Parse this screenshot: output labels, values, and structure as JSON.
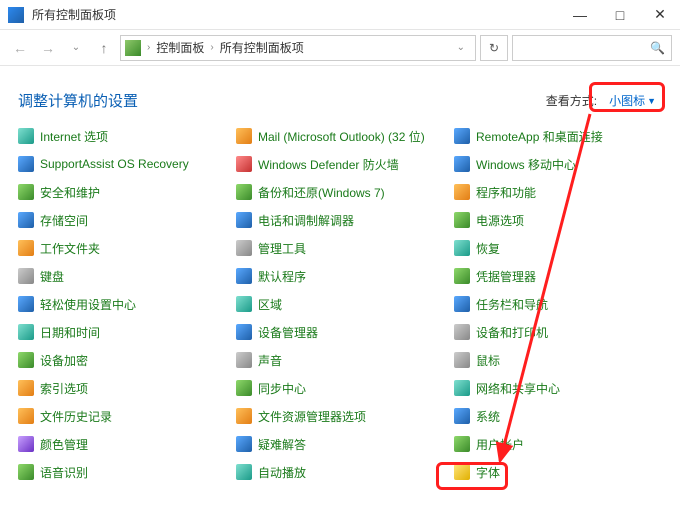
{
  "window": {
    "title": "所有控制面板项",
    "min": "—",
    "max": "□",
    "close": "✕"
  },
  "nav": {
    "back": "←",
    "forward": "→",
    "up": "↑",
    "crumb1": "控制面板",
    "crumb2": "所有控制面板项",
    "refresh": "↻",
    "search_icon": "🔍"
  },
  "header": {
    "heading": "调整计算机的设置",
    "view_label": "查看方式:",
    "view_value": "小图标"
  },
  "items": {
    "col1": [
      {
        "label": "Internet 选项",
        "ic": "ic-teal"
      },
      {
        "label": "SupportAssist OS Recovery",
        "ic": "ic-blue"
      },
      {
        "label": "安全和维护",
        "ic": "ic-green"
      },
      {
        "label": "存储空间",
        "ic": "ic-blue"
      },
      {
        "label": "工作文件夹",
        "ic": "ic-orange"
      },
      {
        "label": "键盘",
        "ic": "ic-gray"
      },
      {
        "label": "轻松使用设置中心",
        "ic": "ic-blue"
      },
      {
        "label": "日期和时间",
        "ic": "ic-teal"
      },
      {
        "label": "设备加密",
        "ic": "ic-green"
      },
      {
        "label": "索引选项",
        "ic": "ic-orange"
      },
      {
        "label": "文件历史记录",
        "ic": "ic-orange"
      },
      {
        "label": "颜色管理",
        "ic": "ic-purple"
      },
      {
        "label": "语音识别",
        "ic": "ic-green"
      }
    ],
    "col2": [
      {
        "label": "Mail (Microsoft Outlook) (32 位)",
        "ic": "ic-orange"
      },
      {
        "label": "Windows Defender 防火墙",
        "ic": "ic-red"
      },
      {
        "label": "备份和还原(Windows 7)",
        "ic": "ic-green"
      },
      {
        "label": "电话和调制解调器",
        "ic": "ic-blue"
      },
      {
        "label": "管理工具",
        "ic": "ic-gray"
      },
      {
        "label": "默认程序",
        "ic": "ic-blue"
      },
      {
        "label": "区域",
        "ic": "ic-teal"
      },
      {
        "label": "设备管理器",
        "ic": "ic-blue"
      },
      {
        "label": "声音",
        "ic": "ic-gray"
      },
      {
        "label": "同步中心",
        "ic": "ic-green"
      },
      {
        "label": "文件资源管理器选项",
        "ic": "ic-orange"
      },
      {
        "label": "疑难解答",
        "ic": "ic-blue"
      },
      {
        "label": "自动播放",
        "ic": "ic-teal"
      }
    ],
    "col3": [
      {
        "label": "RemoteApp 和桌面连接",
        "ic": "ic-blue"
      },
      {
        "label": "Windows 移动中心",
        "ic": "ic-blue"
      },
      {
        "label": "程序和功能",
        "ic": "ic-orange"
      },
      {
        "label": "电源选项",
        "ic": "ic-green"
      },
      {
        "label": "恢复",
        "ic": "ic-teal"
      },
      {
        "label": "凭据管理器",
        "ic": "ic-green"
      },
      {
        "label": "任务栏和导航",
        "ic": "ic-blue"
      },
      {
        "label": "设备和打印机",
        "ic": "ic-gray"
      },
      {
        "label": "鼠标",
        "ic": "ic-gray"
      },
      {
        "label": "网络和共享中心",
        "ic": "ic-teal"
      },
      {
        "label": "系统",
        "ic": "ic-blue"
      },
      {
        "label": "用户帐户",
        "ic": "ic-green"
      },
      {
        "label": "字体",
        "ic": "ic-yellow"
      }
    ]
  }
}
